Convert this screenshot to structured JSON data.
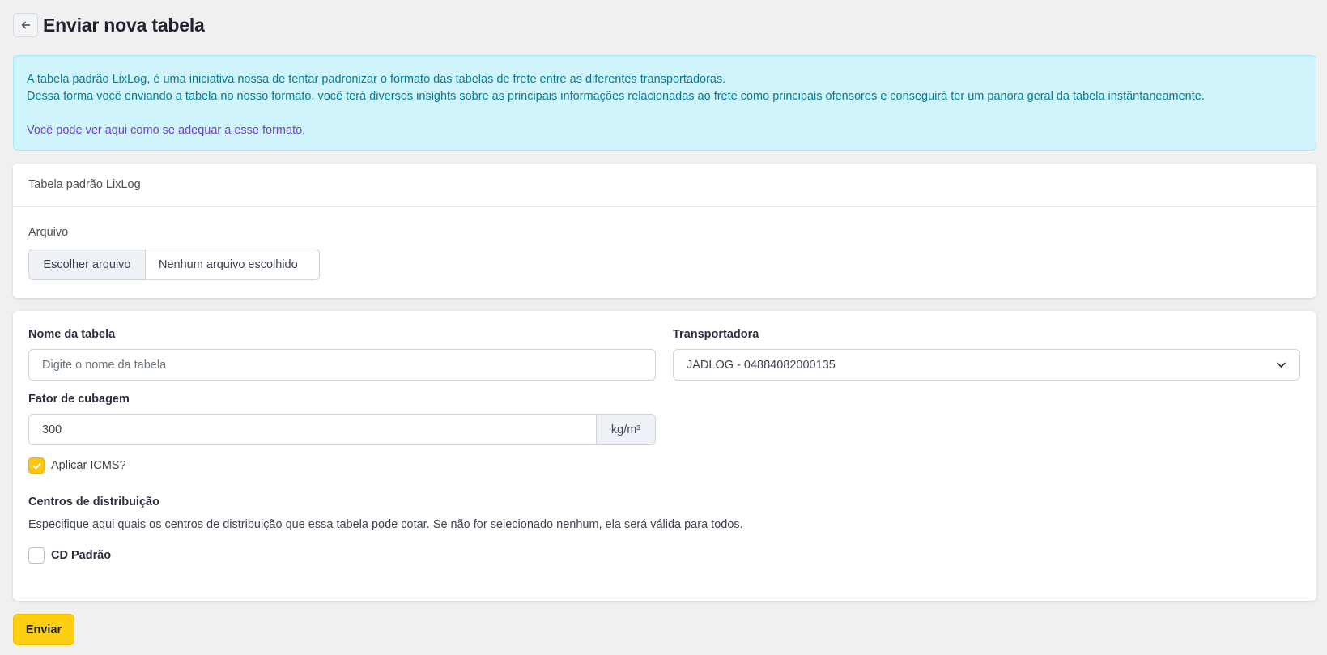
{
  "page": {
    "title": "Enviar nova tabela"
  },
  "alert": {
    "line1": "A tabela padrão LixLog, é uma iniciativa nossa de tentar padronizar o formato das tabelas de frete entre as diferentes transportadoras.",
    "line2": "Dessa forma você enviando a tabela no nosso formato, você terá diversos insights sobre as principais informações relacionadas ao frete como principais ofensores e conseguirá ter um panora geral da tabela instântaneamente.",
    "link_text": "Você pode ver aqui como se adequar a esse formato."
  },
  "upload_card": {
    "header": "Tabela padrão LixLog",
    "file_label": "Arquivo",
    "choose_button": "Escolher arquivo",
    "file_status": "Nenhum arquivo escolhido"
  },
  "form": {
    "name_label": "Nome da tabela",
    "name_placeholder": "Digite o nome da tabela",
    "name_value": "",
    "carrier_label": "Transportadora",
    "carrier_value": "JADLOG - 04884082000135",
    "cubage_label": "Fator de cubagem",
    "cubage_value": "300",
    "cubage_unit": "kg/m³",
    "icms_label": "Aplicar ICMS?",
    "icms_checked": true,
    "dc_title": "Centros de distribuição",
    "dc_help": "Especifique aqui quais os centros de distribuição que essa tabela pode cotar. Se não for selecionado nenhum, ela será válida para todos.",
    "dc_options": [
      {
        "label": "CD Padrão",
        "checked": false
      }
    ]
  },
  "submit_label": "Enviar",
  "colors": {
    "accent": "#fccf10",
    "alert_bg": "#cff4fc",
    "alert_text": "#087990",
    "link": "#6f42c1",
    "background": "#f0f0f0"
  },
  "icons": {
    "back": "arrow-left-icon",
    "dropdown": "chevron-down-icon",
    "check": "check-icon"
  }
}
